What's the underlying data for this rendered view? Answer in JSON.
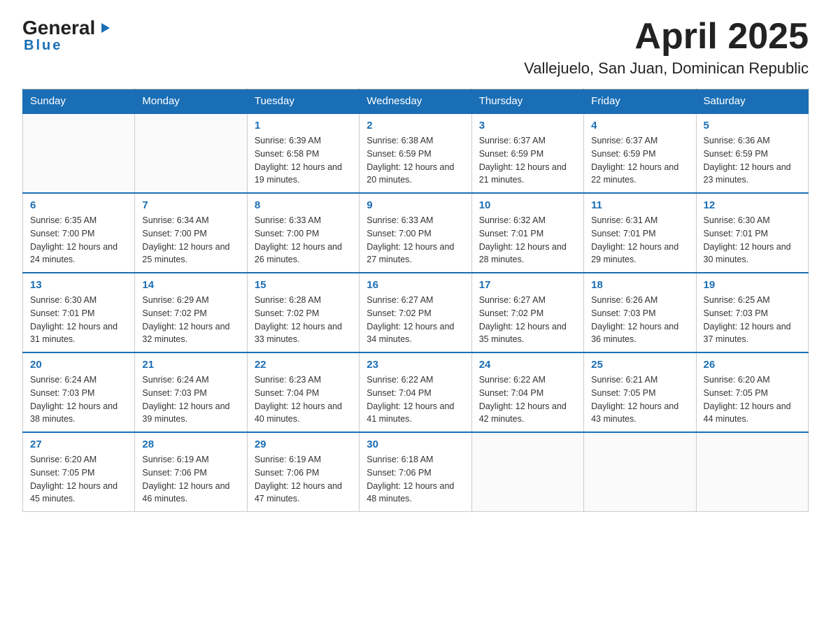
{
  "header": {
    "logo_general": "General",
    "logo_blue": "Blue",
    "title": "April 2025",
    "subtitle": "Vallejuelo, San Juan, Dominican Republic"
  },
  "calendar": {
    "days_of_week": [
      "Sunday",
      "Monday",
      "Tuesday",
      "Wednesday",
      "Thursday",
      "Friday",
      "Saturday"
    ],
    "weeks": [
      [
        {
          "day": "",
          "sunrise": "",
          "sunset": "",
          "daylight": ""
        },
        {
          "day": "",
          "sunrise": "",
          "sunset": "",
          "daylight": ""
        },
        {
          "day": "1",
          "sunrise": "Sunrise: 6:39 AM",
          "sunset": "Sunset: 6:58 PM",
          "daylight": "Daylight: 12 hours and 19 minutes."
        },
        {
          "day": "2",
          "sunrise": "Sunrise: 6:38 AM",
          "sunset": "Sunset: 6:59 PM",
          "daylight": "Daylight: 12 hours and 20 minutes."
        },
        {
          "day": "3",
          "sunrise": "Sunrise: 6:37 AM",
          "sunset": "Sunset: 6:59 PM",
          "daylight": "Daylight: 12 hours and 21 minutes."
        },
        {
          "day": "4",
          "sunrise": "Sunrise: 6:37 AM",
          "sunset": "Sunset: 6:59 PM",
          "daylight": "Daylight: 12 hours and 22 minutes."
        },
        {
          "day": "5",
          "sunrise": "Sunrise: 6:36 AM",
          "sunset": "Sunset: 6:59 PM",
          "daylight": "Daylight: 12 hours and 23 minutes."
        }
      ],
      [
        {
          "day": "6",
          "sunrise": "Sunrise: 6:35 AM",
          "sunset": "Sunset: 7:00 PM",
          "daylight": "Daylight: 12 hours and 24 minutes."
        },
        {
          "day": "7",
          "sunrise": "Sunrise: 6:34 AM",
          "sunset": "Sunset: 7:00 PM",
          "daylight": "Daylight: 12 hours and 25 minutes."
        },
        {
          "day": "8",
          "sunrise": "Sunrise: 6:33 AM",
          "sunset": "Sunset: 7:00 PM",
          "daylight": "Daylight: 12 hours and 26 minutes."
        },
        {
          "day": "9",
          "sunrise": "Sunrise: 6:33 AM",
          "sunset": "Sunset: 7:00 PM",
          "daylight": "Daylight: 12 hours and 27 minutes."
        },
        {
          "day": "10",
          "sunrise": "Sunrise: 6:32 AM",
          "sunset": "Sunset: 7:01 PM",
          "daylight": "Daylight: 12 hours and 28 minutes."
        },
        {
          "day": "11",
          "sunrise": "Sunrise: 6:31 AM",
          "sunset": "Sunset: 7:01 PM",
          "daylight": "Daylight: 12 hours and 29 minutes."
        },
        {
          "day": "12",
          "sunrise": "Sunrise: 6:30 AM",
          "sunset": "Sunset: 7:01 PM",
          "daylight": "Daylight: 12 hours and 30 minutes."
        }
      ],
      [
        {
          "day": "13",
          "sunrise": "Sunrise: 6:30 AM",
          "sunset": "Sunset: 7:01 PM",
          "daylight": "Daylight: 12 hours and 31 minutes."
        },
        {
          "day": "14",
          "sunrise": "Sunrise: 6:29 AM",
          "sunset": "Sunset: 7:02 PM",
          "daylight": "Daylight: 12 hours and 32 minutes."
        },
        {
          "day": "15",
          "sunrise": "Sunrise: 6:28 AM",
          "sunset": "Sunset: 7:02 PM",
          "daylight": "Daylight: 12 hours and 33 minutes."
        },
        {
          "day": "16",
          "sunrise": "Sunrise: 6:27 AM",
          "sunset": "Sunset: 7:02 PM",
          "daylight": "Daylight: 12 hours and 34 minutes."
        },
        {
          "day": "17",
          "sunrise": "Sunrise: 6:27 AM",
          "sunset": "Sunset: 7:02 PM",
          "daylight": "Daylight: 12 hours and 35 minutes."
        },
        {
          "day": "18",
          "sunrise": "Sunrise: 6:26 AM",
          "sunset": "Sunset: 7:03 PM",
          "daylight": "Daylight: 12 hours and 36 minutes."
        },
        {
          "day": "19",
          "sunrise": "Sunrise: 6:25 AM",
          "sunset": "Sunset: 7:03 PM",
          "daylight": "Daylight: 12 hours and 37 minutes."
        }
      ],
      [
        {
          "day": "20",
          "sunrise": "Sunrise: 6:24 AM",
          "sunset": "Sunset: 7:03 PM",
          "daylight": "Daylight: 12 hours and 38 minutes."
        },
        {
          "day": "21",
          "sunrise": "Sunrise: 6:24 AM",
          "sunset": "Sunset: 7:03 PM",
          "daylight": "Daylight: 12 hours and 39 minutes."
        },
        {
          "day": "22",
          "sunrise": "Sunrise: 6:23 AM",
          "sunset": "Sunset: 7:04 PM",
          "daylight": "Daylight: 12 hours and 40 minutes."
        },
        {
          "day": "23",
          "sunrise": "Sunrise: 6:22 AM",
          "sunset": "Sunset: 7:04 PM",
          "daylight": "Daylight: 12 hours and 41 minutes."
        },
        {
          "day": "24",
          "sunrise": "Sunrise: 6:22 AM",
          "sunset": "Sunset: 7:04 PM",
          "daylight": "Daylight: 12 hours and 42 minutes."
        },
        {
          "day": "25",
          "sunrise": "Sunrise: 6:21 AM",
          "sunset": "Sunset: 7:05 PM",
          "daylight": "Daylight: 12 hours and 43 minutes."
        },
        {
          "day": "26",
          "sunrise": "Sunrise: 6:20 AM",
          "sunset": "Sunset: 7:05 PM",
          "daylight": "Daylight: 12 hours and 44 minutes."
        }
      ],
      [
        {
          "day": "27",
          "sunrise": "Sunrise: 6:20 AM",
          "sunset": "Sunset: 7:05 PM",
          "daylight": "Daylight: 12 hours and 45 minutes."
        },
        {
          "day": "28",
          "sunrise": "Sunrise: 6:19 AM",
          "sunset": "Sunset: 7:06 PM",
          "daylight": "Daylight: 12 hours and 46 minutes."
        },
        {
          "day": "29",
          "sunrise": "Sunrise: 6:19 AM",
          "sunset": "Sunset: 7:06 PM",
          "daylight": "Daylight: 12 hours and 47 minutes."
        },
        {
          "day": "30",
          "sunrise": "Sunrise: 6:18 AM",
          "sunset": "Sunset: 7:06 PM",
          "daylight": "Daylight: 12 hours and 48 minutes."
        },
        {
          "day": "",
          "sunrise": "",
          "sunset": "",
          "daylight": ""
        },
        {
          "day": "",
          "sunrise": "",
          "sunset": "",
          "daylight": ""
        },
        {
          "day": "",
          "sunrise": "",
          "sunset": "",
          "daylight": ""
        }
      ]
    ]
  }
}
